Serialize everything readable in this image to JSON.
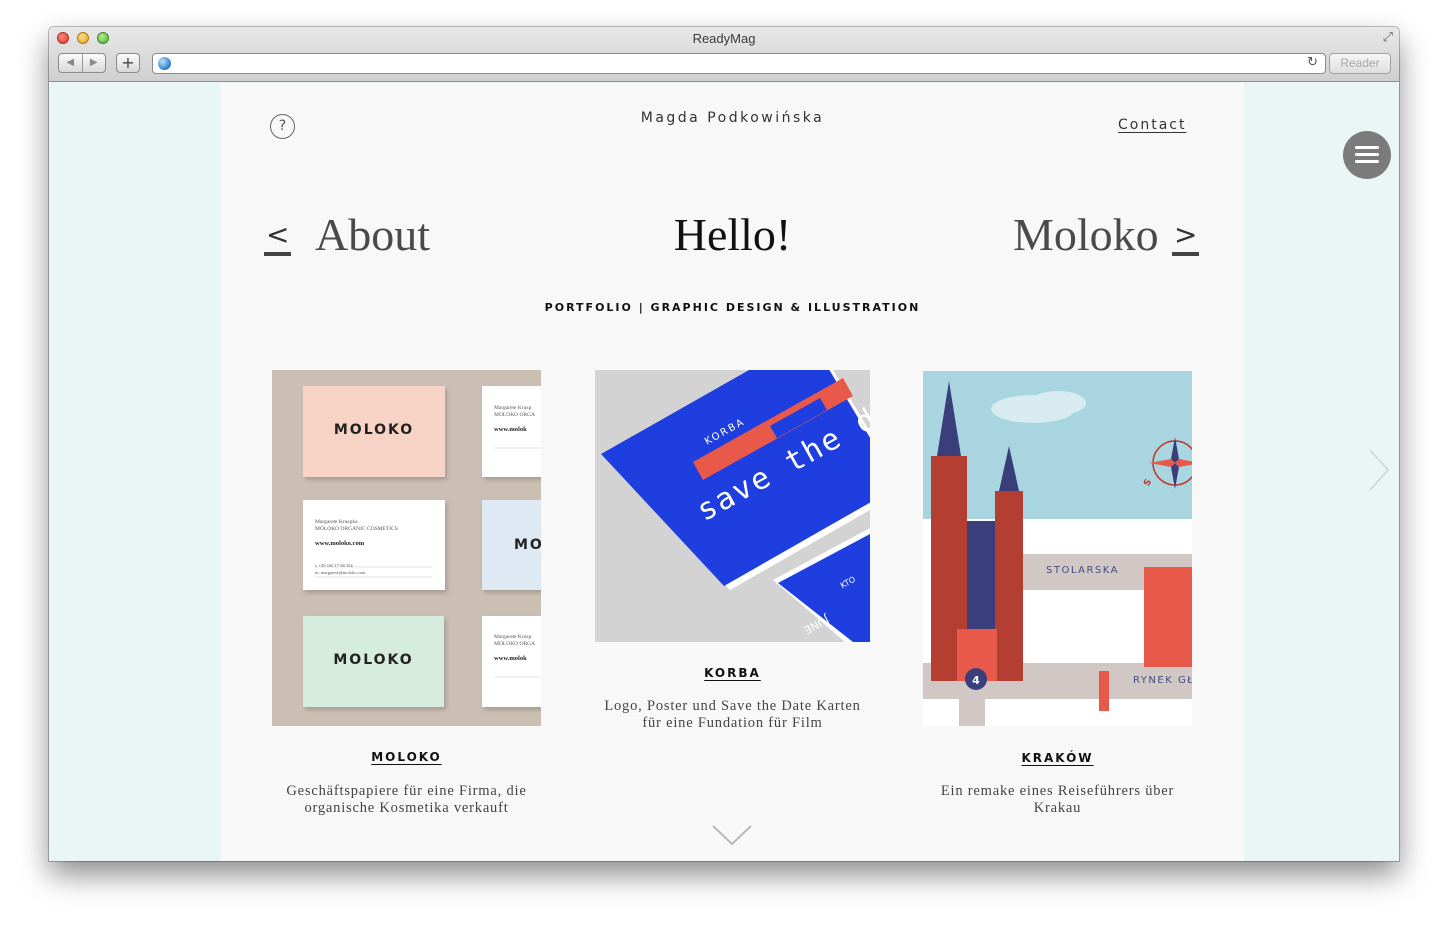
{
  "browser": {
    "title": "ReadyMag",
    "reader_label": "Reader",
    "url": ""
  },
  "site": {
    "name": "Magda Podkowińska",
    "contact": "Contact"
  },
  "nav": {
    "prev_arrow": "<",
    "prev_label": "About",
    "current_label": "Hello!",
    "next_label": "Moloko",
    "next_arrow": ">"
  },
  "subtitle": "PORTFOLIO | GRAPHIC DESIGN & ILLUSTRATION",
  "projects": [
    {
      "title": "MOLOKO",
      "description_line1": "Geschäftspapiere für eine Firma, die",
      "description_line2": "organische Kosmetika verkauft",
      "image_text": {
        "card1": "MOLOKO",
        "card2": "MOLOKO",
        "card3": "MO",
        "web": "www.moloko.com",
        "name": "Margarete Kruspka",
        "company": "MOLOKO ORGANIC COSMETICS",
        "phone": "t: +49 160 17 68 354",
        "email": "m: margarete@moloko.com",
        "web_partial": "www.molok",
        "name_partial": "Margarete Krusp",
        "company_partial": "MOLOKO ORGA"
      }
    },
    {
      "title": "KORBA",
      "description_line1": "Logo, Poster und Save the Date Karten",
      "description_line2": "für eine Fundation für Film",
      "image_text": {
        "brand": "KORBA",
        "slogan": "save the da",
        "small": "KTO",
        "small2": "JUNE"
      }
    },
    {
      "title": "KRAKÓW",
      "description_line1": "Ein remake eines Reiseführers über",
      "description_line2": "Krakau",
      "image_text": {
        "street1": "STOLARSKA",
        "street2": "RYNEK GŁ",
        "marker": "4",
        "compass": "S"
      }
    }
  ],
  "colors": {
    "accent_blue": "#1f3ee0",
    "accent_red": "#e8594a",
    "mint": "#e9f6f4"
  }
}
